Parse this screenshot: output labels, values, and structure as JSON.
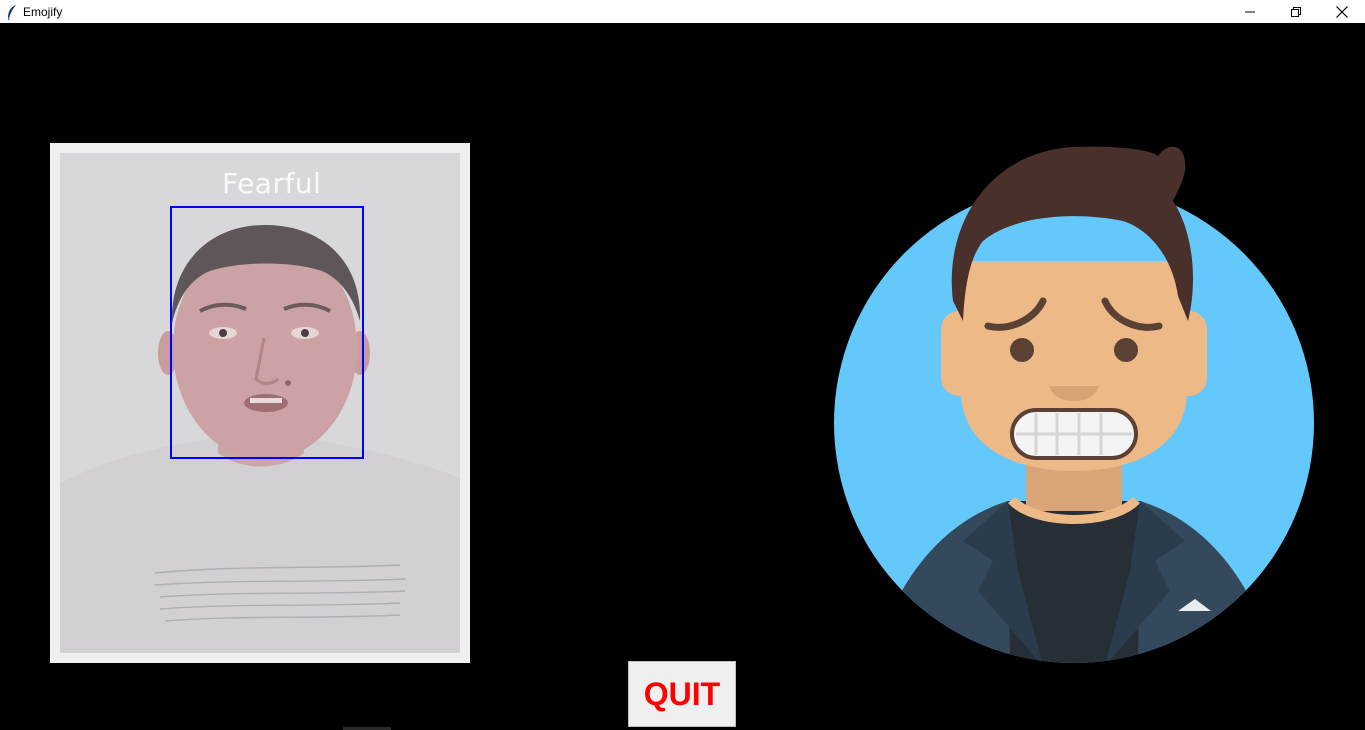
{
  "window": {
    "title": "Emojify",
    "minimize_icon": "minimize-icon",
    "restore_icon": "restore-icon",
    "close_icon": "close-icon"
  },
  "video": {
    "emotion_label": "Fearful",
    "face_box_color": "#0000ff",
    "label_color": "#fafafa"
  },
  "emoji": {
    "icon": "fearful-face-avatar-icon",
    "background_color": "#64c8fb",
    "skin_color": "#ecb987",
    "hair_color": "#4a302b",
    "jacket_color": "#34495c"
  },
  "quit_button": {
    "label": "QUIT",
    "text_color": "#ff0000"
  }
}
